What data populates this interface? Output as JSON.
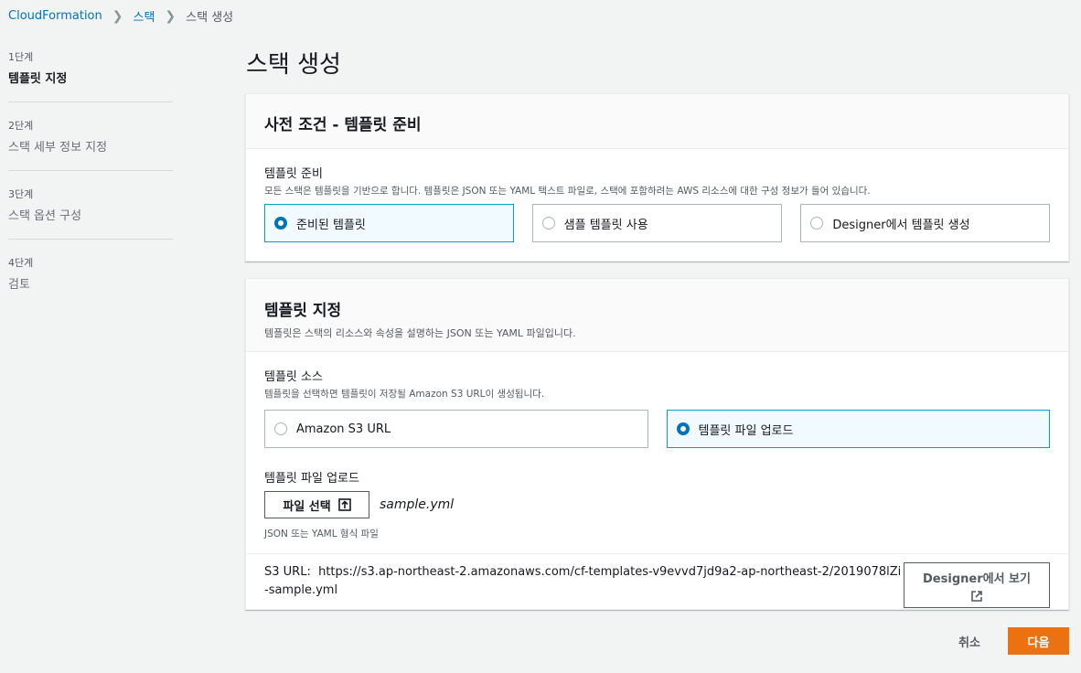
{
  "breadcrumb": {
    "items": [
      "CloudFormation",
      "스택",
      "스택 생성"
    ]
  },
  "steps": [
    {
      "num": "1단계",
      "title": "템플릿 지정",
      "active": true
    },
    {
      "num": "2단계",
      "title": "스택 세부 정보 지정",
      "active": false
    },
    {
      "num": "3단계",
      "title": "스택 옵션 구성",
      "active": false
    },
    {
      "num": "4단계",
      "title": "검토",
      "active": false
    }
  ],
  "page_title": "스택 생성",
  "prereq": {
    "title": "사전 조건 - 템플릿 준비",
    "field_label": "템플릿 준비",
    "field_desc": "모든 스택은 템플릿을 기반으로 합니다. 템플릿은 JSON 또는 YAML 텍스트 파일로, 스택에 포함하려는 AWS 리소스에 대한 구성 정보가 들어 있습니다.",
    "options": [
      "준비된 템플릿",
      "샘플 템플릿 사용",
      "Designer에서 템플릿 생성"
    ],
    "selected": "준비된 템플릿"
  },
  "template": {
    "title": "템플릿 지정",
    "subtitle": "템플릿은 스택의 리소스와 속성을 설명하는 JSON 또는 YAML 파일입니다.",
    "source_label": "템플릿 소스",
    "source_desc": "템플릿을 선택하면 템플릿이 저장될 Amazon S3 URL이 생성됩니다.",
    "source_options": [
      "Amazon S3 URL",
      "템플릿 파일 업로드"
    ],
    "source_selected": "템플릿 파일 업로드",
    "upload_label": "템플릿 파일 업로드",
    "choose_file_label": "파일 선택",
    "file_name": "sample.yml",
    "upload_hint": "JSON 또는 YAML 형식 파일",
    "s3_url_label": "S3 URL:",
    "s3_url": "https://s3.ap-northeast-2.amazonaws.com/cf-templates-v9evvd7jd9a2-ap-northeast-2/2019078lZi-sample.yml",
    "designer_button": "Designer에서 보기"
  },
  "footer": {
    "cancel": "취소",
    "next": "다음"
  },
  "colors": {
    "link": "#0073bb",
    "primary": "#ec7211",
    "selected_border": "#00a1c9",
    "selected_bg": "#f1faff"
  }
}
